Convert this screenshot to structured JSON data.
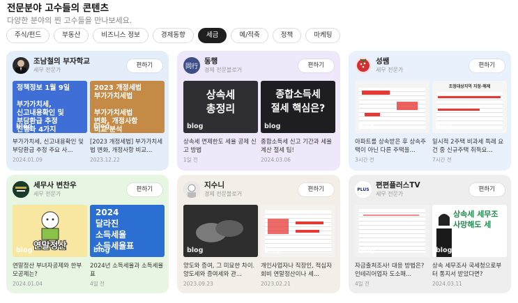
{
  "header": {
    "title": "전문분야 고수들의 콘텐츠",
    "subtitle": "다양한 분야의 찐 고수들을 만나보세요."
  },
  "tabs": [
    "주식/펀드",
    "부동산",
    "비즈니스 정보",
    "경제동향",
    "세금",
    "예/적축",
    "정책",
    "마케팅"
  ],
  "active_tab": "세금",
  "subscribe_label": "편하기",
  "blog_label": "blog",
  "colors": {
    "card_blue": "#e4eefb",
    "card_purple": "#efe8fb",
    "card_sky": "#e8f1fc",
    "card_green": "#e6f6e2",
    "card_beige": "#f3efe8",
    "card_gray": "#eeeeee"
  },
  "cards": [
    {
      "name": "조남철의 부자학교",
      "role": "세무 전문가",
      "posts": [
        {
          "thumb": "정책정보 1월 9일\n\n부가가치세,\n신고내용확인 및\n부담환급 추정\n진행과 4가지",
          "title": "부가가치세, 신고내용확인 및 부당환급 추정 주요 사...",
          "date": "2024.01.09"
        },
        {
          "thumb": "2023 개정세법\n부가가치세법\n\n부가가치세법\n변화, 개정사항\n비교 분석",
          "title": "[2023 개정세법] 부가가치세법 변화, 개정사항 비교...",
          "date": "2023.12.22"
        }
      ]
    },
    {
      "name": "동행",
      "role": "경제 전문블로거",
      "posts": [
        {
          "thumb": "상속세\n총정리",
          "title": "상속세 면제한도 세율 공제 신고 방법",
          "date": "1일 전"
        },
        {
          "thumb": "종합소득세\n절세 핵심은?",
          "title": "종합소득세 신고 기간과 세율 계산 절세 팁!",
          "date": "2024.03.06"
        }
      ]
    },
    {
      "name": "성쌤",
      "role": "세무 전문가",
      "posts": [
        {
          "thumb": "",
          "title": "아파트를 상속받은 후 상속주택이 아닌 다른 주택을...",
          "date": "3시간 전"
        },
        {
          "thumb": "조정대상지역 지정·해제",
          "title": "일시적 2주택 비과세 특례 요건 중 신규주택 취득요...",
          "date": "7시간 전"
        }
      ]
    },
    {
      "name": "세무사 변찬우",
      "role": "세무 전문가",
      "posts": [
        {
          "thumb": "연말정산",
          "title": "연말정산 부녀자공제와 한부모공제는?",
          "date": "2024.01.04"
        },
        {
          "thumb": "2024\n달라진\n소득세율\n소득세율표",
          "title": "2024년 소득세율과 소득세율표",
          "date": "4일 전"
        }
      ]
    },
    {
      "name": "지수니",
      "role": "경제 전문블로거",
      "posts": [
        {
          "thumb": "",
          "title": "양도와 증여, 그 미묘한 차이. 양도세와 증여세와 관...",
          "date": "2023.09.23"
        },
        {
          "thumb": "",
          "title": "개인사업자나 직장인, 적십자회비 연말정산이나 세...",
          "date": "2023.02.21"
        }
      ]
    },
    {
      "name": "편편플러스TV",
      "role": "세무 전문가",
      "posts": [
        {
          "thumb": "",
          "title": "자금출처조사! 대응 방법은? 인테리어업자 도소매...",
          "date": "4일 전"
        },
        {
          "thumb": "상속세 세무조\n사망해도 세",
          "title": "상속 세무조사 국세청으로부터 통지서 받았다면?",
          "date": "2024.03.11"
        }
      ]
    }
  ]
}
